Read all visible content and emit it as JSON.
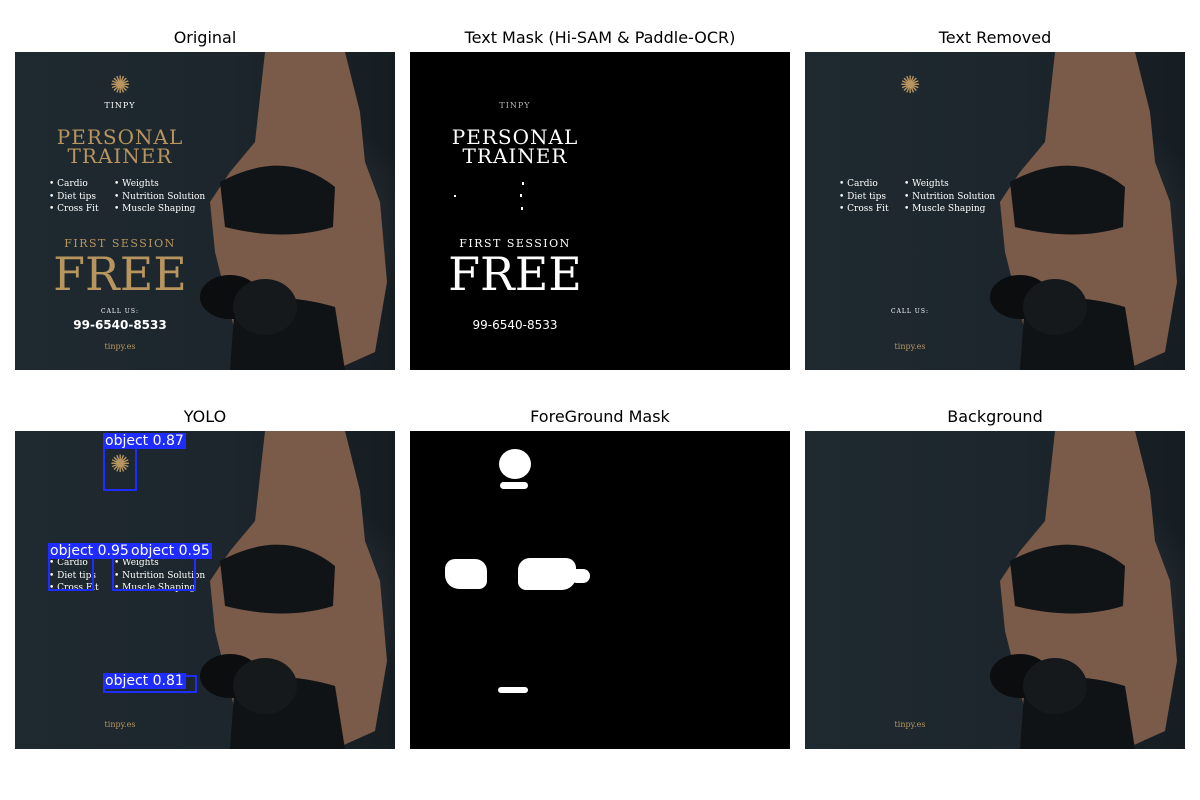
{
  "panels": [
    {
      "title": "Original"
    },
    {
      "title": "Text Mask (Hi-SAM & Paddle-OCR)"
    },
    {
      "title": "Text Removed"
    },
    {
      "title": "YOLO"
    },
    {
      "title": "ForeGround Mask"
    },
    {
      "title": "Background"
    }
  ],
  "poster": {
    "brand": "TINPY",
    "heading_line1": "PERSONAL",
    "heading_line2": "TRAINER",
    "list_left": [
      "Cardio",
      "Diet tips",
      "Cross Fit"
    ],
    "list_right": [
      "Weights",
      "Nutrition Solution",
      "Muscle Shaping"
    ],
    "first_session": "FIRST SESSION",
    "free": "FREE",
    "call_us": "CALL US:",
    "phone": "99-6540-8533",
    "website": "tinpy.es"
  },
  "text_removed": {
    "list_left": [
      "Cardio",
      "Diet tips",
      "Cross Fit"
    ],
    "list_right": [
      "Weights",
      "Nutrition Solution",
      "Muscle Shaping"
    ],
    "call_us": "CALL US:",
    "website": "tinpy.es"
  },
  "yolo": {
    "detections": [
      "object 0.87",
      "object 0.95",
      "object 0.95",
      "object 0.81"
    ],
    "list_left": [
      "Cardio",
      "Diet tips",
      "Cross Fit"
    ],
    "list_right": [
      "Weights",
      "Nutrition Solution",
      "Muscle Shaping"
    ],
    "website": "tinpy.es"
  },
  "background": {
    "website": "tinpy.es"
  },
  "colors": {
    "gold": "#b8955f",
    "yolo_blue": "#1e2cff",
    "poster_bg": "#1f2a30"
  }
}
